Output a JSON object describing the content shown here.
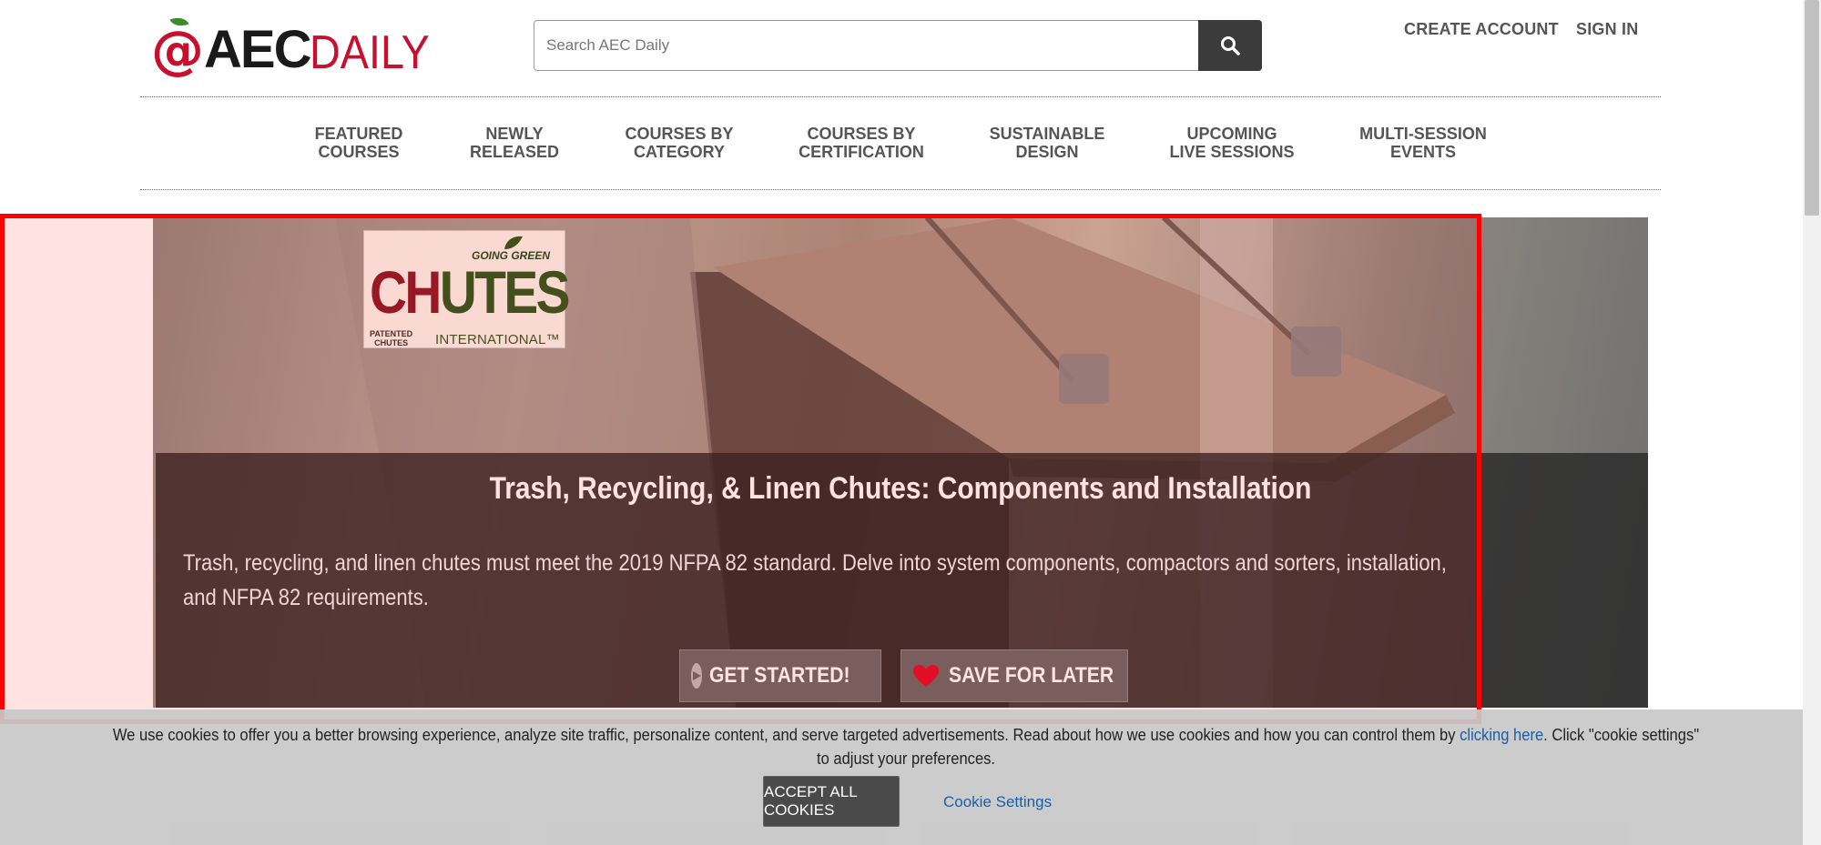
{
  "header": {
    "logo": {
      "at": "@",
      "aec": "AEC",
      "daily": "DAILY"
    },
    "search": {
      "placeholder": "Search AEC Daily"
    },
    "links": {
      "create_account": "CREATE ACCOUNT",
      "sign_in": "SIGN IN"
    }
  },
  "nav": {
    "items": [
      {
        "line1": "FEATURED",
        "line2": "COURSES"
      },
      {
        "line1": "NEWLY",
        "line2": "RELEASED"
      },
      {
        "line1": "COURSES BY",
        "line2": "CATEGORY"
      },
      {
        "line1": "COURSES BY",
        "line2": "CERTIFICATION"
      },
      {
        "line1": "SUSTAINABLE",
        "line2": "DESIGN"
      },
      {
        "line1": "UPCOMING",
        "line2": "LIVE SESSIONS"
      },
      {
        "line1": "MULTI-SESSION",
        "line2": "EVENTS"
      }
    ]
  },
  "hero": {
    "brand": {
      "going_green": "GOING GREEN",
      "chutes_a": "CH",
      "chutes_b": "UTES",
      "patented_1": "PATENTED",
      "patented_2": "CHUTES",
      "international": "INTERNATIONAL™"
    },
    "title": "Trash, Recycling, & Linen Chutes: Components and Installation",
    "description": "Trash, recycling, and linen chutes must meet the 2019 NFPA 82 standard. Delve into system components, compactors and sorters, installation, and NFPA 82 requirements.",
    "get_started": "GET STARTED!",
    "save_for_later": "SAVE FOR LATER"
  },
  "cookie": {
    "glyph": "",
    "text_before": " We use cookies to offer you a better browsing experience, analyze site traffic, personalize content, and serve targeted advertisements. Read about how we use cookies and how you can control them by ",
    "link": "clicking here",
    "text_after": ". Click \"cookie settings\" to adjust your preferences.",
    "accept": "ACCEPT ALL COOKIES",
    "settings": "Cookie Settings"
  },
  "colors": {
    "brand_red": "#c8102e",
    "brand_green": "#2e5a1f",
    "highlight": "#ff0000",
    "link": "#1a5ea8",
    "heart": "#e0102a"
  }
}
